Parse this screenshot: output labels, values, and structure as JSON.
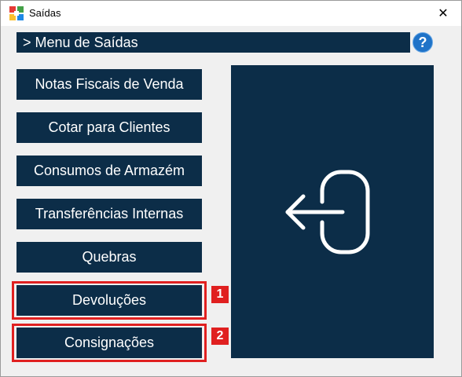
{
  "window": {
    "title": "Saídas",
    "close_glyph": "✕"
  },
  "header": {
    "title": "> Menu de Saídas",
    "help_label": "?"
  },
  "menu": {
    "items": [
      {
        "label": "Notas Fiscais de Venda"
      },
      {
        "label": "Cotar para Clientes"
      },
      {
        "label": "Consumos de Armazém"
      },
      {
        "label": "Transferências Internas"
      },
      {
        "label": "Quebras"
      },
      {
        "label": "Devoluções"
      },
      {
        "label": "Consignações"
      }
    ]
  },
  "highlights": [
    {
      "badge": "1",
      "target": "Devoluções"
    },
    {
      "badge": "2",
      "target": "Consignações"
    }
  ],
  "panel": {
    "icon": "exit-arrow-icon"
  },
  "colors": {
    "navy": "#0c2d48",
    "highlight": "#e02020",
    "help": "#1f73c8",
    "background": "#f0f0f0"
  }
}
